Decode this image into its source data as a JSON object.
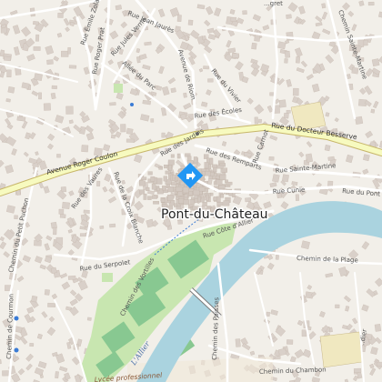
{
  "place": {
    "name": "Pont-du-Château",
    "marker_icon": "location-diamond-icon",
    "marker_color": "#2196f3"
  },
  "colors": {
    "background": "#f2efe9",
    "building": "#d9d0c9",
    "water": "#aad3df",
    "park": "#c8e6b0",
    "pitch": "#88c891",
    "primary_road": "#f7fabf",
    "primary_casing": "#c7b66a"
  },
  "roads": {
    "avenue_roger_coulon": "Avenue Roger Coulon",
    "rue_du_docteur_besserve": "Rue du Docteur Besserve",
    "rue_emile_zola": "Rue Émile Zola",
    "rue_roger_prat": "Rue Roger Prat",
    "rue_jean_jaures": "Rue Jean Jaurès",
    "rue_jules_verne": "Rue Jules Verne",
    "allee_du_parc": "Allée du Parc",
    "avenue_de_riom": "Avenue de Riom",
    "rue_du_vivier": "Rue du Vivier",
    "rue_des_ecoles": "Rue des Écoles",
    "rue_des_jardins": "Rue des Jardins",
    "rue_des_remparts": "Rue des Remparts",
    "rue_carnot": "Rue Carnot",
    "rue_sainte_martine": "Rue Sainte-Martine",
    "rue_cunie": "Rue Cunie",
    "rue_du_pont": "Rue du Pont",
    "rue_des_vaures": "Rue des Vaures",
    "rue_de_la_croix_blanche": "Rue de la Croix Blanche",
    "rue_cote_d_allier": "Rue Côte d'Allier",
    "rue_du_serpolet": "Rue du Serpolet",
    "chemin_du_petit_puchon": "Chemin du Petit Puchon",
    "chemin_des_vortilles": "Chemin des Vortilles",
    "chemin_de_la_plage": "Chemin de la Plage",
    "chemin_des_paisses": "Chemin des Paisses",
    "chemin_du_chambon": "Chemin du Chambon",
    "chemin_de_courmon": "Chemin de Courmon",
    "chemin_sainte_martine": "Chemin Sainte-Martine",
    "lallier": "L'Allier",
    "lycee_professionnel": "Lycée professionnel"
  },
  "label_text": {
    "ldier": "..dier",
    "lagret": "...gret"
  }
}
